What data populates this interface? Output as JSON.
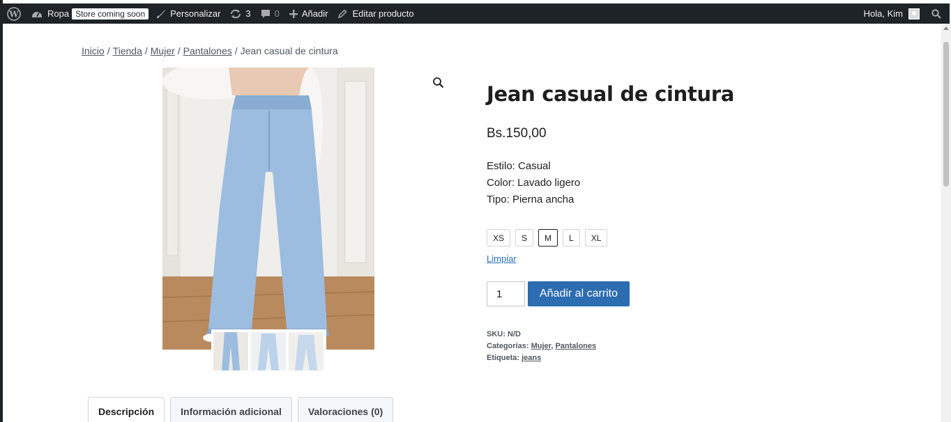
{
  "adminbar": {
    "site_name": "Ropa",
    "badge": "Store coming soon",
    "customize": "Personalizar",
    "updates_count": "3",
    "comments_count": "0",
    "add_new": "Añadir",
    "edit_product": "Editar producto",
    "greeting": "Hola, Kim",
    "colors": {
      "bar": "#1d2327",
      "text": "#f0f0f1"
    }
  },
  "breadcrumb": {
    "items": [
      "Inicio",
      "Tienda",
      "Mujer",
      "Pantalones"
    ],
    "current": "Jean casual de cintura",
    "separator": "/"
  },
  "product": {
    "title": "Jean casual de cintura",
    "price": "Bs.150,00",
    "attributes": [
      "Estilo: Casual",
      "Color: Lavado ligero",
      "Tipo: Pierna ancha"
    ],
    "sizes": [
      "XS",
      "S",
      "M",
      "L",
      "XL"
    ],
    "selected_size": "M",
    "clear_label": "Limpiar",
    "quantity": "1",
    "add_to_cart": "Añadir al carrito",
    "sku_label": "SKU:",
    "sku_value": "N/D",
    "categories_label": "Categorías:",
    "categories": [
      "Mujer",
      "Pantalones"
    ],
    "tag_label": "Etiqueta:",
    "tag": "jeans",
    "accent_color": "#2c6cb0"
  },
  "tabs": [
    "Descripción",
    "Información adicional",
    "Valoraciones (0)"
  ],
  "active_tab": "Descripción"
}
